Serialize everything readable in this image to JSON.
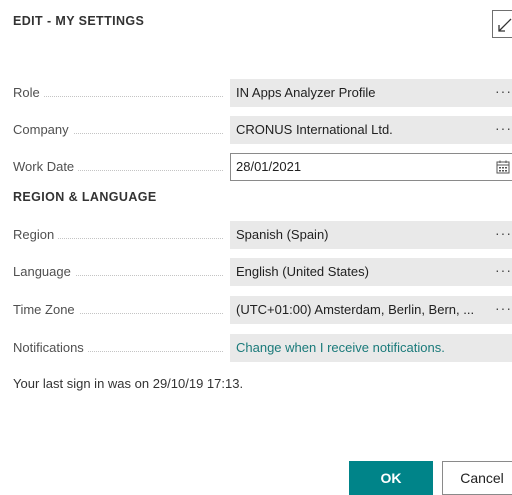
{
  "dialog": {
    "title": "EDIT - MY SETTINGS",
    "expand_icon": "expand-diagonal-arrow-icon"
  },
  "fields": [
    {
      "label": "Role",
      "value": "IN Apps Analyzer Profile",
      "action": "ellipsis"
    },
    {
      "label": "Company",
      "value": "CRONUS International Ltd.",
      "action": "ellipsis"
    },
    {
      "label": "Work Date",
      "value": "28/01/2021",
      "action": "calendar"
    }
  ],
  "region_section": {
    "title": "REGION & LANGUAGE",
    "fields": [
      {
        "label": "Region",
        "value": "Spanish (Spain)",
        "action": "ellipsis"
      },
      {
        "label": "Language",
        "value": "English (United States)",
        "action": "ellipsis"
      },
      {
        "label": "Time Zone",
        "value": "(UTC+01:00) Amsterdam, Berlin, Bern, ...",
        "action": "ellipsis"
      },
      {
        "label": "Notifications",
        "value": "Change when I receive notifications.",
        "action": "link"
      }
    ]
  },
  "ellipsis_glyph": "···",
  "last_sign_in": "Your last sign in was on 29/10/19 17:13.",
  "buttons": {
    "ok": "OK",
    "cancel": "Cancel"
  },
  "colors": {
    "accent": "#008489",
    "link": "#1a7a7a",
    "readonly_field": "#e9e9e9"
  }
}
